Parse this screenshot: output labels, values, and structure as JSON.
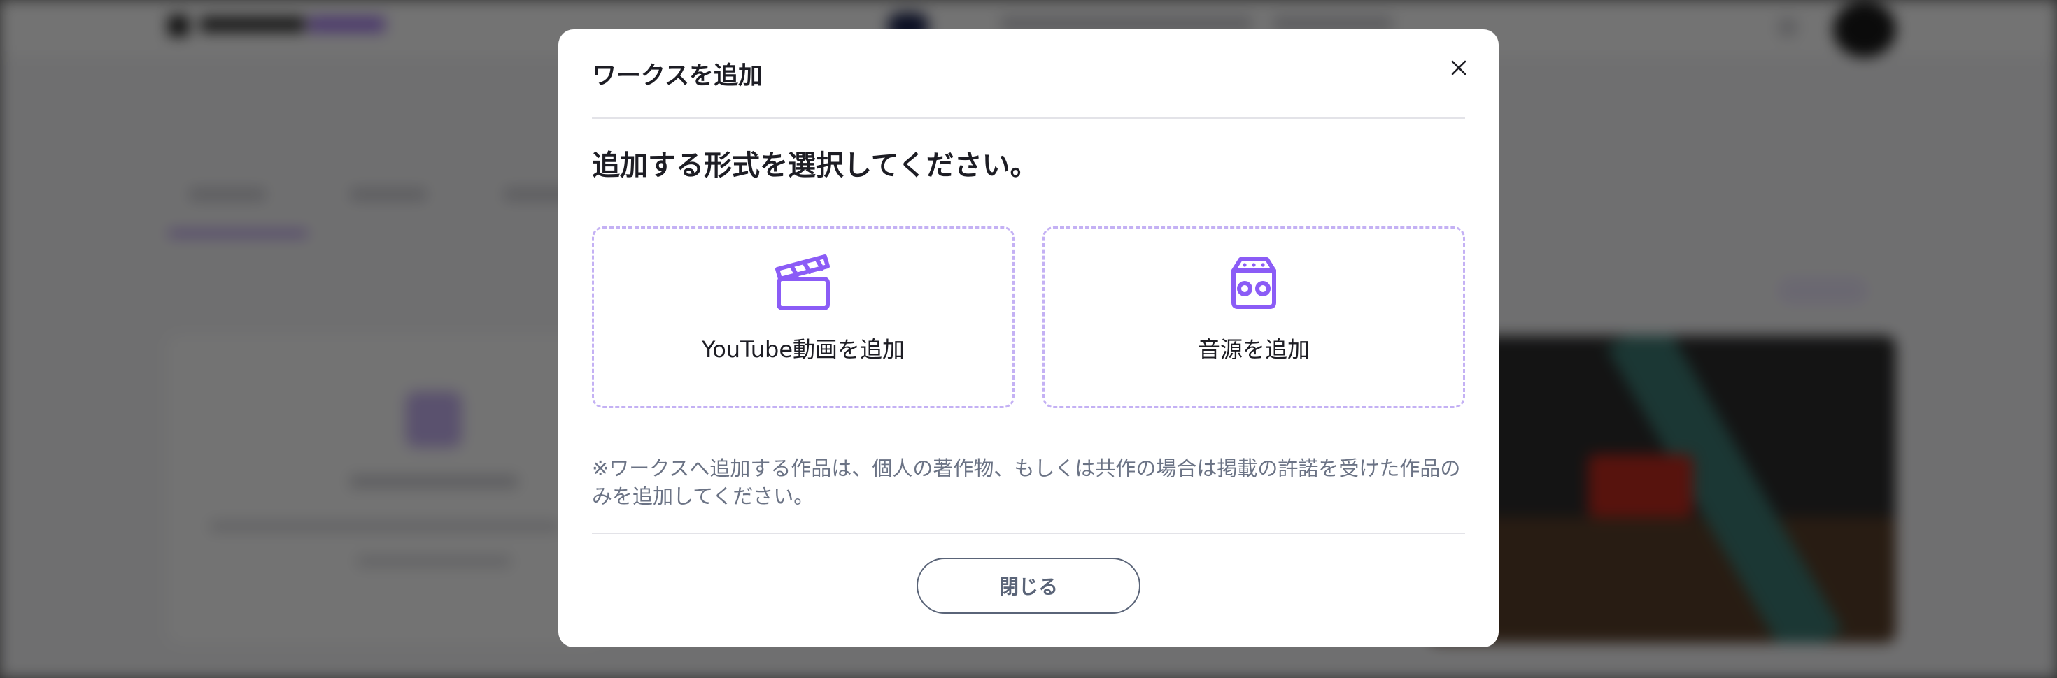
{
  "modal": {
    "title": "ワークスを追加",
    "question": "追加する形式を選択してください。",
    "options": [
      {
        "label": "YouTube動画を追加",
        "icon": "clapperboard-icon"
      },
      {
        "label": "音源を追加",
        "icon": "radio-icon"
      }
    ],
    "note": "※ワークスへ追加する作品は、個人の著作物、もしくは共作の場合は掲載の許諾を受けた作品のみを追加してください。",
    "close_label": "閉じる",
    "close_icon": "close-icon"
  },
  "colors": {
    "accent": "#8b5cf6",
    "dashed_border": "#c4b1f4",
    "note_text": "#6b7385",
    "button_outline": "#5a6478"
  }
}
